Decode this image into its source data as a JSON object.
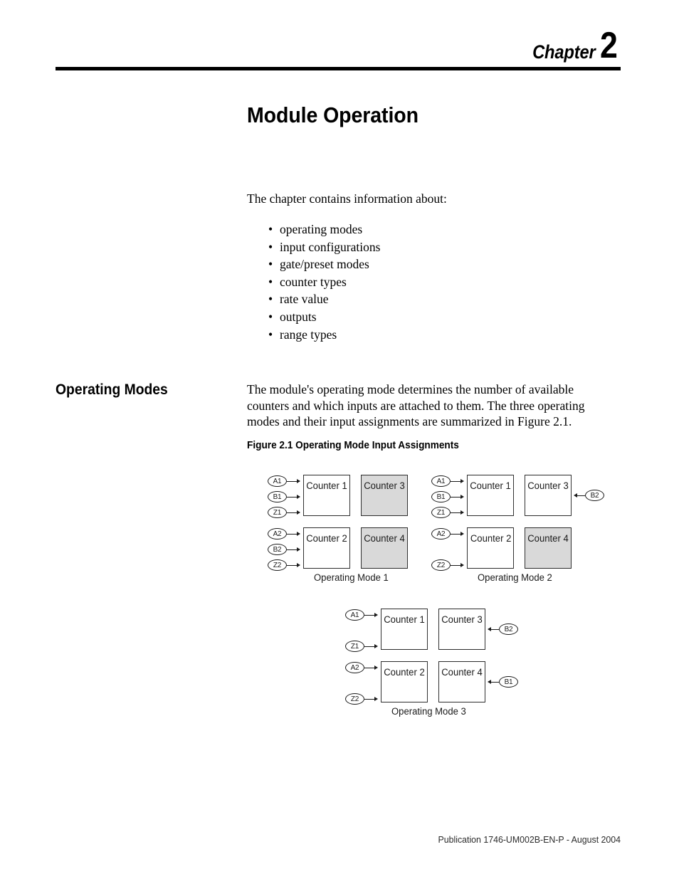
{
  "header": {
    "chapter_word": "Chapter",
    "chapter_number": "2"
  },
  "page_title": "Module Operation",
  "intro": {
    "lead_in": "The chapter contains information about:",
    "bullet_glyph": "•",
    "items": [
      "operating modes",
      "input configurations",
      "gate/preset modes",
      "counter types",
      "rate value",
      "outputs",
      "range types"
    ]
  },
  "section": {
    "heading": "Operating Modes",
    "body": "The module's operating mode determines the number of available counters and which inputs are attached to them. The three operating modes and their input assignments are summarized in Figure 2.1."
  },
  "figure": {
    "caption": "Figure 2.1 Operating Mode Input Assignments",
    "modes": [
      {
        "label": "Operating Mode 1",
        "boxes": [
          {
            "name": "Counter 1",
            "shaded": false
          },
          {
            "name": "Counter 3",
            "shaded": true
          },
          {
            "name": "Counter 2",
            "shaded": false
          },
          {
            "name": "Counter 4",
            "shaded": true
          }
        ],
        "inputs": [
          "A1",
          "B1",
          "Z1",
          "A2",
          "B2",
          "Z2"
        ]
      },
      {
        "label": "Operating Mode 2",
        "boxes": [
          {
            "name": "Counter 1",
            "shaded": false
          },
          {
            "name": "Counter 3",
            "shaded": false
          },
          {
            "name": "Counter 2",
            "shaded": false
          },
          {
            "name": "Counter 4",
            "shaded": true
          }
        ],
        "inputs": [
          "A1",
          "B1",
          "Z1",
          "A2",
          "Z2"
        ],
        "right_inputs": [
          "B2"
        ]
      },
      {
        "label": "Operating Mode 3",
        "boxes": [
          {
            "name": "Counter 1",
            "shaded": false
          },
          {
            "name": "Counter 3",
            "shaded": false
          },
          {
            "name": "Counter 2",
            "shaded": false
          },
          {
            "name": "Counter 4",
            "shaded": false
          }
        ],
        "inputs": [
          "A1",
          "Z1",
          "A2",
          "Z2"
        ],
        "right_inputs": [
          "B2",
          "B1"
        ]
      }
    ]
  },
  "footer": {
    "publication": "Publication 1746-UM002B-EN-P - August 2004"
  },
  "colors": {
    "shaded_box": "#d9d9d9",
    "line": "#1a1a1a",
    "text": "#000000"
  }
}
